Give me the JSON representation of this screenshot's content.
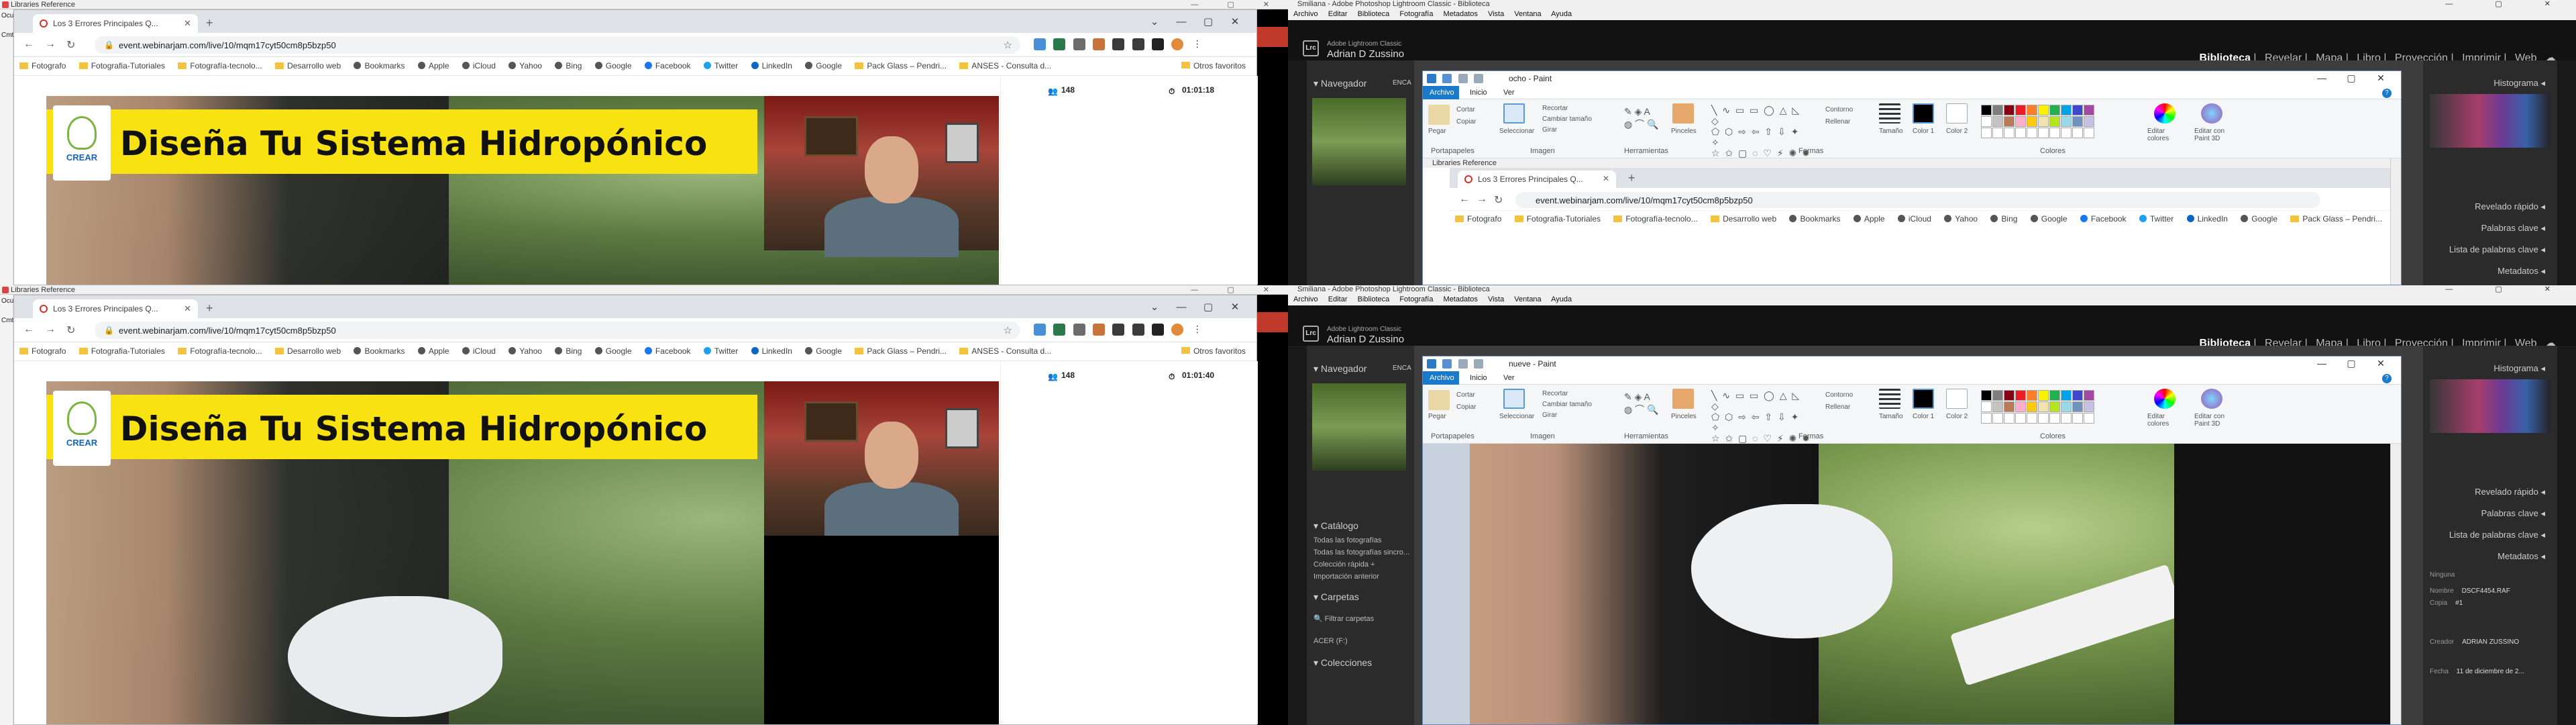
{
  "chrome": {
    "outer_strip_title": "Libraries Reference",
    "left_edge_labels": [
      "Ocul",
      "Cmt"
    ],
    "tab_title": "Los 3 Errores Principales Q...",
    "url": "event.webinarjam.com/live/10/mqm17cyt50cm8p5bzp50",
    "bookmarks": [
      "Fotografo",
      "Fotografia-Tutoriales",
      "Fotografía-tecnolo...",
      "Desarrollo web",
      "Bookmarks",
      "Apple",
      "iCloud",
      "Yahoo",
      "Bing",
      "Google",
      "Facebook",
      "Twitter",
      "LinkedIn",
      "Google",
      "Pack Glass – Pendri...",
      "ANSES - Consulta d..."
    ],
    "bookmarks_other": "Otros favoritos",
    "banner_title": "Diseña Tu Sistema Hidropónico",
    "logo_text": "CREAR",
    "attendees": "148",
    "timer_top": "01:01:18",
    "timer_bottom": "01:01:40"
  },
  "lightroom": {
    "strip_title": "Smiliana - Adobe Photoshop Lightroom Classic - Biblioteca",
    "menu": [
      "Archivo",
      "Editar",
      "Biblioteca",
      "Fotografía",
      "Metadatos",
      "Vista",
      "Ventana",
      "Ayuda"
    ],
    "user_small": "Adobe Lightroom Classic",
    "user": "Adrian D Zussino",
    "modules": [
      "Biblioteca",
      "Revelar",
      "Mapa",
      "Libro",
      "Proyección",
      "Imprimir",
      "Web"
    ],
    "left_panel": "Navegador",
    "left_panel_fit": "ENCA",
    "catalog_header": "Catálogo",
    "catalog_items": [
      "Todas las fotografías",
      "Todas las fotografías sincro...",
      "Colección rápida +",
      "Importación anterior"
    ],
    "folders_header": "Carpetas",
    "folders_filter": "Filtrar carpetas",
    "folder_disk": "ACER (F:)",
    "collections_header": "Colecciones",
    "right_panels": [
      "Histograma",
      "Revelado rápido",
      "Palabras clave",
      "Lista de palabras clave",
      "Metadatos"
    ],
    "meta_fields": [
      {
        "label": "Ninguna",
        "value": ""
      },
      {
        "label": "Nombre",
        "value": "DSCF4454.RAF"
      },
      {
        "label": "Copia",
        "value": "#1"
      },
      {
        "label": "Creador",
        "value": "ADRIAN ZUSSINO"
      },
      {
        "label": "Fecha",
        "value": "11 de diciembre de 2..."
      }
    ]
  },
  "paint": {
    "title_top": "ocho - Paint",
    "title_bottom": "nueve - Paint",
    "tabs": [
      "Archivo",
      "Inicio",
      "Ver"
    ],
    "groups": [
      "Portapapeles",
      "Imagen",
      "Herramientas",
      "Formas",
      "Colores"
    ],
    "clipboard": {
      "paste": "Pegar",
      "cut": "Cortar",
      "copy": "Copiar"
    },
    "image": {
      "select": "Seleccionar",
      "crop": "Recortar",
      "resize": "Cambiar tamaño",
      "rotate": "Girar"
    },
    "brushes": "Pinceles",
    "shape_opts": {
      "outline": "Contorno",
      "fill": "Rellenar"
    },
    "size": "Tamaño",
    "color1": "Color 1",
    "color2": "Color 2",
    "edit_colors": "Editar colores",
    "paint3d": "Editar con Paint 3D",
    "palette": [
      "#000000",
      "#7f7f7f",
      "#880015",
      "#ed1c24",
      "#ff7f27",
      "#fff200",
      "#22b14c",
      "#00a2e8",
      "#3f48cc",
      "#a349a4",
      "#ffffff",
      "#c3c3c3",
      "#b97a57",
      "#ffaec9",
      "#ffc90e",
      "#efe4b0",
      "#b5e61d",
      "#99d9ea",
      "#7092be",
      "#c8bfe7"
    ]
  }
}
